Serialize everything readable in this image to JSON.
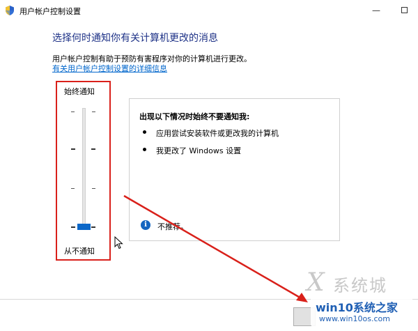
{
  "window": {
    "title": "用户帐户控制设置"
  },
  "heading": "选择何时通知你有关计算机更改的消息",
  "description": "用户帐户控制有助于预防有害程序对你的计算机进行更改。",
  "link_text": "有关用户帐户控制设置的详细信息",
  "slider": {
    "top_label": "始终通知",
    "bottom_label": "从不通知",
    "levels": 4,
    "selected_level": 1
  },
  "info_panel": {
    "title": "出现以下情况时始终不要通知我:",
    "bullets": [
      "应用尝试安装软件或更改我的计算机",
      "我更改了 Windows 设置"
    ],
    "note": "不推荐。"
  },
  "icons": {
    "app": "uac-shield-icon",
    "info": "info-icon",
    "cursor": "mouse-cursor-icon"
  },
  "watermark": {
    "brand": "系统城",
    "site_name": "win10系统之家",
    "url": "www.win10os.com"
  },
  "colors": {
    "heading": "#1e3287",
    "link": "#0066cc",
    "annotation_red": "#d9201a",
    "slider_thumb": "#0b67c8",
    "watermark_blue": "#1f5fb4"
  }
}
